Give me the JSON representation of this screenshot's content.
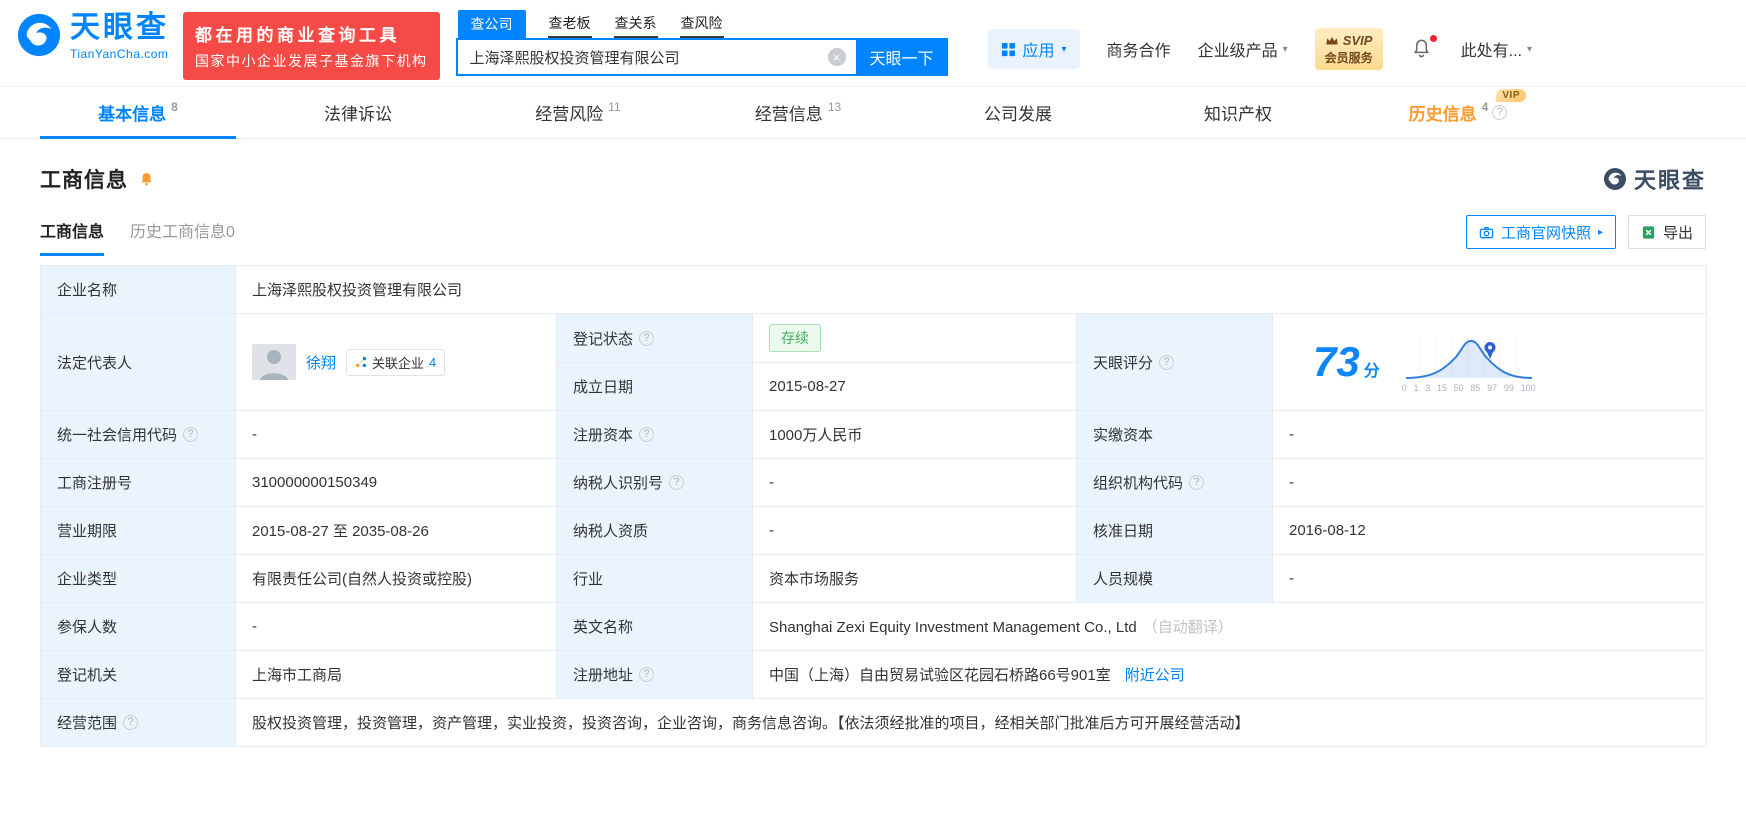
{
  "icons": {
    "help": "?",
    "clear": "×",
    "caret": "▾",
    "arrow": "▸"
  },
  "header": {
    "logo": {
      "brand": "天眼查",
      "domain": "TianYanCha.com"
    },
    "banner": {
      "line1": "都在用的商业查询工具",
      "line2": "国家中小企业发展子基金旗下机构"
    },
    "search": {
      "tabs": [
        {
          "label": "查公司"
        },
        {
          "label": "查老板"
        },
        {
          "label": "查关系"
        },
        {
          "label": "查风险"
        }
      ],
      "value": "上海泽熙股权投资管理有限公司",
      "button_label": "天眼一下"
    },
    "menu": {
      "apps": "应用",
      "business_coop": "商务合作",
      "enterprise_products": "企业级产品",
      "svip_title": "SVIP",
      "svip_subtitle": "会员服务",
      "user": "此处有..."
    }
  },
  "nav_tabs": [
    {
      "label": "基本信息",
      "count": "8"
    },
    {
      "label": "法律诉讼"
    },
    {
      "label": "经营风险",
      "count": "11"
    },
    {
      "label": "经营信息",
      "count": "13"
    },
    {
      "label": "公司发展"
    },
    {
      "label": "知识产权"
    },
    {
      "label": "历史信息",
      "count": "4",
      "vip": "VIP"
    }
  ],
  "section": {
    "title": "工商信息",
    "watermark_brand": "天眼查",
    "sub_tabs": [
      {
        "label": "工商信息"
      },
      {
        "label": "历史工商信息0"
      }
    ],
    "snapshot_button": "工商官网快照",
    "export_button": "导出"
  },
  "biz": {
    "company_name_label": "企业名称",
    "company_name": "上海泽熙股权投资管理有限公司",
    "legal_rep_label": "法定代表人",
    "legal_rep_name": "徐翔",
    "related_label": "关联企业",
    "related_count": "4",
    "reg_status_label": "登记状态",
    "reg_status": "存续",
    "score_label": "天眼评分",
    "score_value": "73",
    "score_unit": "分",
    "score_axis": [
      "0",
      "1",
      "3",
      "15",
      "50",
      "85",
      "97",
      "99",
      "100"
    ],
    "est_date_label": "成立日期",
    "est_date": "2015-08-27",
    "credit_code_label": "统一社会信用代码",
    "credit_code": "-",
    "reg_capital_label": "注册资本",
    "reg_capital": "1000万人民币",
    "paid_capital_label": "实缴资本",
    "paid_capital": "-",
    "reg_number_label": "工商注册号",
    "reg_number": "310000000150349",
    "taxpayer_id_label": "纳税人识别号",
    "taxpayer_id": "-",
    "org_code_label": "组织机构代码",
    "org_code": "-",
    "term_label": "营业期限",
    "term": "2015-08-27 至 2035-08-26",
    "taxpayer_quality_label": "纳税人资质",
    "taxpayer_quality": "-",
    "approve_date_label": "核准日期",
    "approve_date": "2016-08-12",
    "company_type_label": "企业类型",
    "company_type": "有限责任公司(自然人投资或控股)",
    "industry_label": "行业",
    "industry": "资本市场服务",
    "staff_label": "人员规模",
    "staff": "-",
    "insured_label": "参保人数",
    "insured": "-",
    "en_name_label": "英文名称",
    "en_name": "Shanghai Zexi Equity Investment Management Co., Ltd",
    "en_name_note": "（自动翻译）",
    "authority_label": "登记机关",
    "authority": "上海市工商局",
    "address_label": "注册地址",
    "address": "中国（上海）自由贸易试验区花园石桥路66号901室",
    "nearby_link": "附近公司",
    "scope_label": "经营范围",
    "scope": "股权投资管理，投资管理，资产管理，实业投资，投资咨询，企业咨询，商务信息咨询。【依法须经批准的项目，经相关部门批准后方可开展经营活动】"
  }
}
